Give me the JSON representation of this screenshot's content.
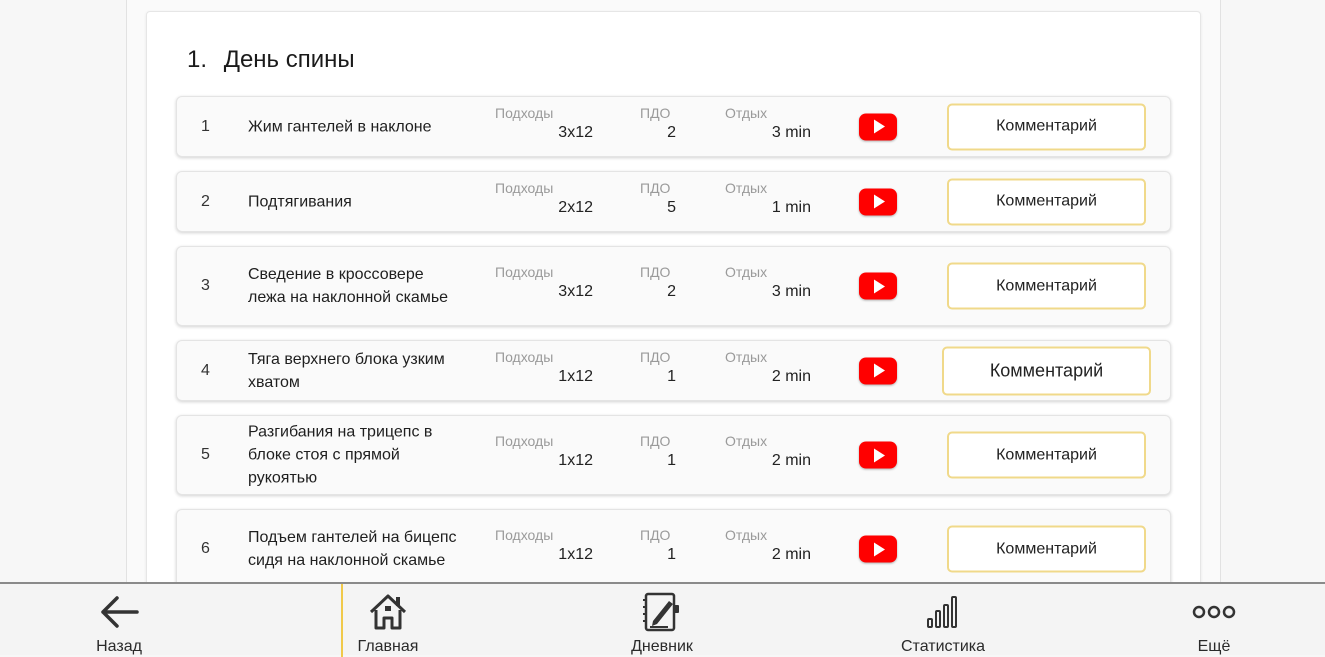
{
  "workout": {
    "number": "1.",
    "title": "День спины"
  },
  "labels": {
    "sets": "Подходы",
    "pdo": "ПДО",
    "rest": "Отдых",
    "comment": "Комментарий"
  },
  "exercises": [
    {
      "index": "1",
      "name": "Жим гантелей в наклоне",
      "sets": "3x12",
      "pdo": "2",
      "rest": "3 min"
    },
    {
      "index": "2",
      "name": "Подтягивания",
      "sets": "2x12",
      "pdo": "5",
      "rest": "1 min"
    },
    {
      "index": "3",
      "name": "Сведение в кроссовере лежа на наклонной скамье",
      "sets": "3x12",
      "pdo": "2",
      "rest": "3 min"
    },
    {
      "index": "4",
      "name": "Тяга верхнего блока узким хватом",
      "sets": "1x12",
      "pdo": "1",
      "rest": "2 min"
    },
    {
      "index": "5",
      "name": "Разгибания на трицепс в блоке стоя с прямой рукоятью",
      "sets": "1x12",
      "pdo": "1",
      "rest": "2 min"
    },
    {
      "index": "6",
      "name": "Подъем гантелей на бицепс сидя на наклонной скамье",
      "sets": "1x12",
      "pdo": "1",
      "rest": "2 min"
    }
  ],
  "nav": {
    "back": "Назад",
    "home": "Главная",
    "diary": "Дневник",
    "stats": "Статистика",
    "more": "Ещё"
  },
  "icons": {
    "video": "youtube-icon",
    "back": "arrow-left-icon",
    "home": "house-icon",
    "diary": "notebook-pen-icon",
    "stats": "bar-chart-icon",
    "more": "three-dots-icon"
  },
  "colors": {
    "youtube": "#ff0000",
    "comment_border": "#f0d98a",
    "active_nav": "#f0c94a"
  }
}
